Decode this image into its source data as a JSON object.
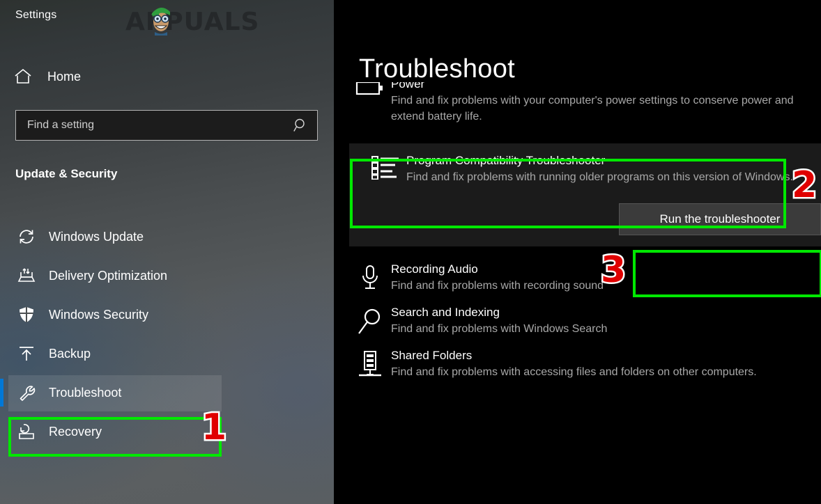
{
  "window": {
    "app_title": "Settings",
    "watermark": "APPUALS"
  },
  "sidebar": {
    "home_label": "Home",
    "home_icon": "home-icon",
    "search": {
      "placeholder": "Find a setting",
      "value": "",
      "icon": "search-icon"
    },
    "section_title": "Update & Security",
    "items": [
      {
        "label": "Windows Update",
        "icon": "sync-refresh-icon",
        "selected": false
      },
      {
        "label": "Delivery Optimization",
        "icon": "delivery-upload-icon",
        "selected": false
      },
      {
        "label": "Windows Security",
        "icon": "shield-icon",
        "selected": false
      },
      {
        "label": "Backup",
        "icon": "upload-arrow-icon",
        "selected": false
      },
      {
        "label": "Troubleshoot",
        "icon": "wrench-icon",
        "selected": true
      },
      {
        "label": "Recovery",
        "icon": "recovery-icon",
        "selected": false
      }
    ]
  },
  "main": {
    "title": "Troubleshoot",
    "troubleshooters": [
      {
        "name": "Power",
        "desc": "Find and fix problems with your computer's power settings to conserve power and extend battery life.",
        "icon": "battery-icon",
        "expanded": false,
        "clipped": true
      },
      {
        "name": "Program Compatibility Troubleshooter",
        "desc": "Find and fix problems with running older programs on this version of Windows.",
        "icon": "list-bullets-icon",
        "expanded": true,
        "clipped": false
      },
      {
        "name": "Recording Audio",
        "desc": "Find and fix problems with recording sound",
        "icon": "microphone-icon",
        "expanded": false,
        "clipped": false
      },
      {
        "name": "Search and Indexing",
        "desc": "Find and fix problems with Windows Search",
        "icon": "magnifier-icon",
        "expanded": false,
        "clipped": false
      },
      {
        "name": "Shared Folders",
        "desc": "Find and fix problems with accessing files and folders on other computers.",
        "icon": "network-server-icon",
        "expanded": false,
        "clipped": false
      }
    ],
    "run_button_label": "Run the troubleshooter"
  },
  "annotations": {
    "highlight_color": "#00e800",
    "badge_color": "#e00000",
    "badges": [
      {
        "number": "1",
        "target": "sidebar-item-troubleshoot"
      },
      {
        "number": "2",
        "target": "program-compatibility-troubleshooter"
      },
      {
        "number": "3",
        "target": "run-troubleshooter-button"
      }
    ]
  }
}
